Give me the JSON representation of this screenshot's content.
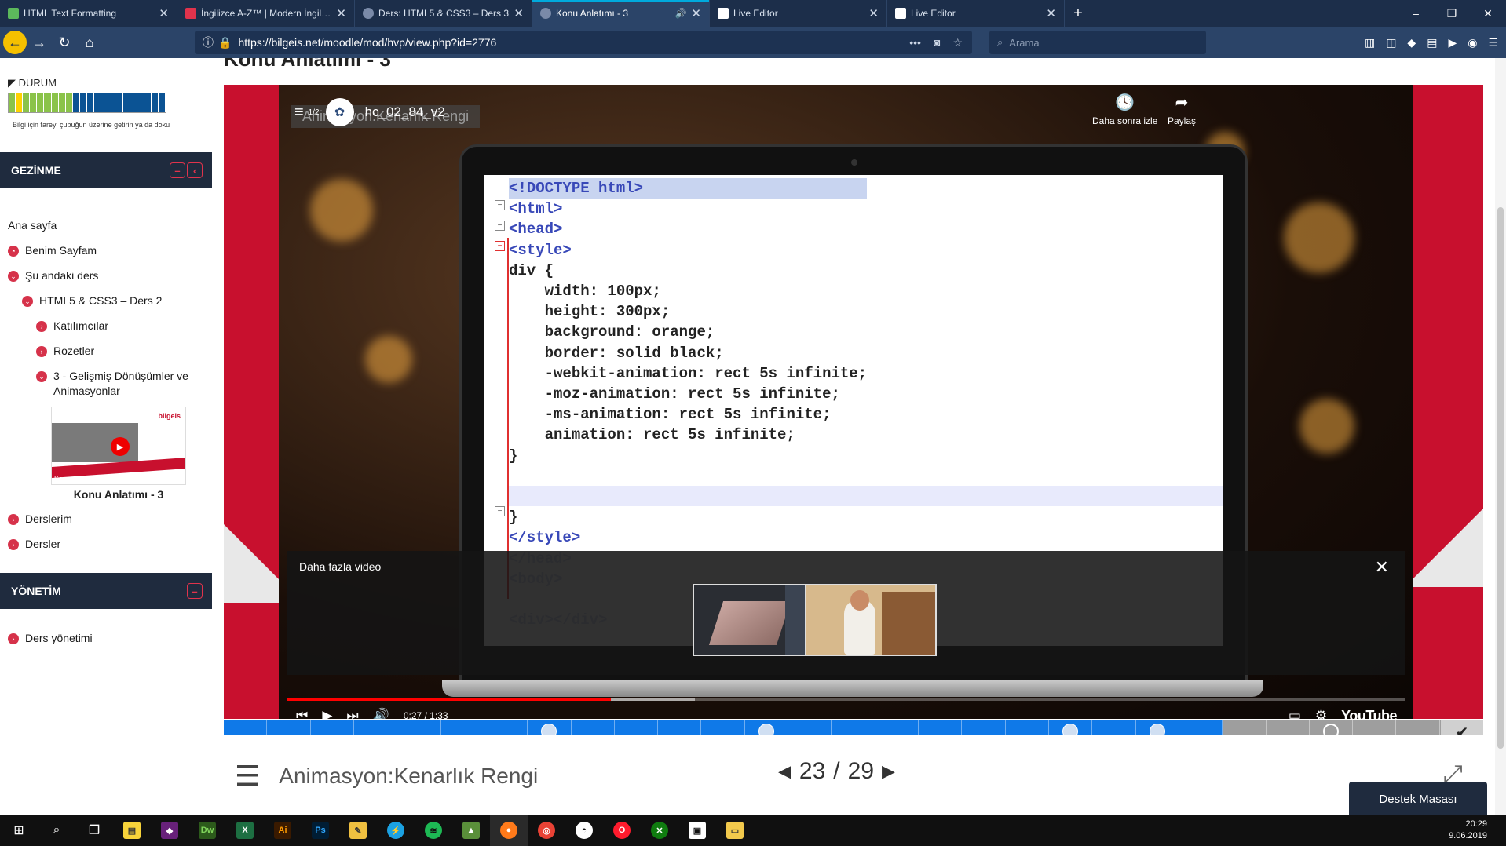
{
  "browser": {
    "tabs": [
      {
        "title": "HTML Text Formatting",
        "favicon_color": "#5cb85c",
        "active": false
      },
      {
        "title": "İngilizce A-Z™ | Modern İngilizce",
        "favicon_color": "#e0334c",
        "active": false
      },
      {
        "title": "Ders: HTML5 & CSS3 – Ders 3",
        "favicon_color": "#7a8aa8",
        "active": false
      },
      {
        "title": "Konu Anlatımı - 3",
        "favicon_color": "#7a8aa8",
        "active": true
      },
      {
        "title": "Live Editor",
        "favicon_color": "#ffffff",
        "active": false
      },
      {
        "title": "Live Editor",
        "favicon_color": "#ffffff",
        "active": false
      }
    ],
    "url": "https://bilgeis.net/moodle/mod/hvp/view.php?id=2776",
    "search_placeholder": "Arama",
    "accent_color": "#2b4468"
  },
  "sidebar": {
    "status_label": "DURUM",
    "progress_colors": [
      "#8bc34a",
      "#ffd200",
      "#8bc34a",
      "#8bc34a",
      "#8bc34a",
      "#8bc34a",
      "#8bc34a",
      "#8bc34a",
      "#8bc34a",
      "#0b5394",
      "#0b5394",
      "#0b5394",
      "#0b5394",
      "#0b5394",
      "#0b5394",
      "#0b5394",
      "#0b5394",
      "#0b5394",
      "#0b5394",
      "#0b5394",
      "#0b5394",
      "#0b5394"
    ],
    "progress_hint": "Bilgi için fareyi çubuğun üzerine getirin ya da doku",
    "nav_header": "GEZİNME",
    "nav_items": [
      {
        "label": "Ana sayfa"
      },
      {
        "label": "Benim Sayfam"
      },
      {
        "label": "Şu andaki ders"
      },
      {
        "label": "HTML5 & CSS3 – Ders 2"
      },
      {
        "label": "Katılımcılar"
      },
      {
        "label": "Rozetler"
      },
      {
        "label": "3 - Gelişmiş Dönüşümler ve Animasyonlar"
      },
      {
        "label": "Derslerim"
      },
      {
        "label": "Dersler"
      }
    ],
    "thumb_caption": "Konu Anlatımı",
    "thumb_logo": "bilgeis",
    "thumb_title": "Konu Anlatımı - 3",
    "admin_header": "YÖNETİM",
    "admin_items": [
      {
        "label": "Ders yönetimi"
      }
    ]
  },
  "main": {
    "page_title": "Konu Anlatımı - 3",
    "video": {
      "playlist_index": "1/2",
      "title": "hc_02_84_v2",
      "ghost_title": "Animasyon:Kenarlık Rengi",
      "watch_later": "Daha sonra izle",
      "share": "Paylaş",
      "more_videos": "Daha fazla video",
      "time": "0:27 / 1:33",
      "progress_fraction": 0.29,
      "brand": "YouTube",
      "code_lines": [
        "<!DOCTYPE html>",
        "<html>",
        "<head>",
        "<style>",
        "div {",
        "    width: 100px;",
        "    height: 300px;",
        "    background: orange;",
        "    border: solid black;",
        "    -webkit-animation: rect 5s infinite;",
        "    -moz-animation: rect 5s infinite;",
        "    -ms-animation: rect 5s infinite;",
        "    animation: rect 5s infinite;",
        "}",
        "",
        "",
        "}",
        "</style>",
        "</head>",
        "<body>",
        "",
        "<div></div>"
      ]
    },
    "slide_title": "Animasyon:Kenarlık Rengi",
    "slide_current": "23",
    "slide_total": "29",
    "pager_sep": "/",
    "help_desk": "Destek Masası"
  },
  "taskbar": {
    "time": "20:29",
    "date": "9.06.2019"
  }
}
